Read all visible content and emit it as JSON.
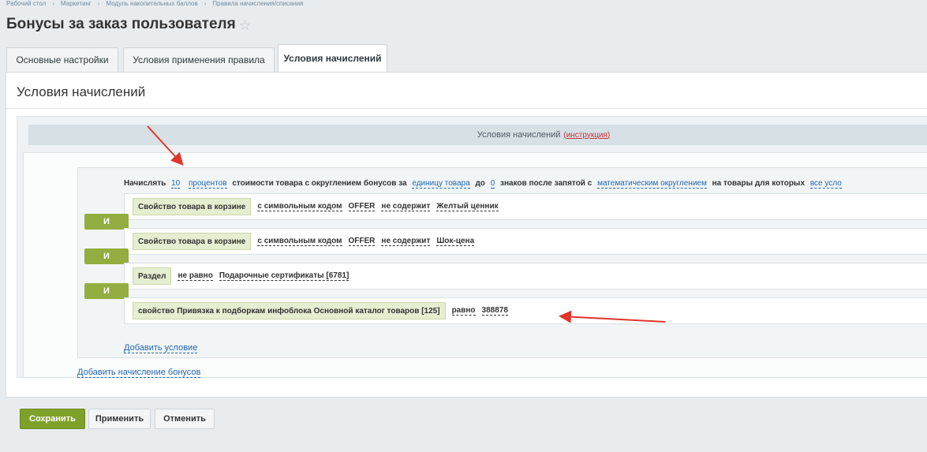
{
  "breadcrumb": [
    "Рабочий стол",
    "Маркетинг",
    "Модуль накопительных баллов",
    "Правила начисления/списания"
  ],
  "page_title": "Бонусы за заказ пользователя",
  "tabs": [
    {
      "label": "Основные настройки",
      "active": false
    },
    {
      "label": "Условия применения правила",
      "active": false
    },
    {
      "label": "Условия начислений",
      "active": true
    }
  ],
  "panel_title": "Условия начислений",
  "conditions_header": {
    "title": "Условия начислений",
    "link": "(инструкция)"
  },
  "main_rule": {
    "t1": "Начислять",
    "amount": "10",
    "unit": "процентов",
    "t2": "стоимости товара с округлением бонусов за",
    "per": "единицу товара",
    "t3": "до",
    "digits": "0",
    "t4": "знаков после запятой с",
    "rounding": "математическим округлением",
    "t5": "на товары для которых",
    "scope": "все усло"
  },
  "conditions": [
    {
      "chip": "Свойство товара в корзине",
      "parts": [
        "с символьным кодом",
        "OFFER",
        "не содержит",
        "Желтый ценник"
      ]
    },
    {
      "chip": "Свойство товара в корзине",
      "parts": [
        "с символьным кодом",
        "OFFER",
        "не содержит",
        "Шок-цена"
      ]
    },
    {
      "chip": "Раздел",
      "parts": [
        "не равно",
        "Подарочные сертификаты [6781]"
      ]
    },
    {
      "chip": "свойство Привязка к подборкам инфоблока Основной каталог товаров [125]",
      "parts": [
        "равно",
        "388878"
      ]
    }
  ],
  "and_label": "И",
  "add_condition": "Добавить условие",
  "add_bonus": "Добавить начисление бонусов",
  "buttons": {
    "save": "Сохранить",
    "apply": "Применить",
    "cancel": "Отменить"
  },
  "colors": {
    "accent_green": "#7fa12a",
    "and_green": "#93ad40",
    "link_blue": "#2067b0",
    "arrow_red": "#e0352b"
  }
}
